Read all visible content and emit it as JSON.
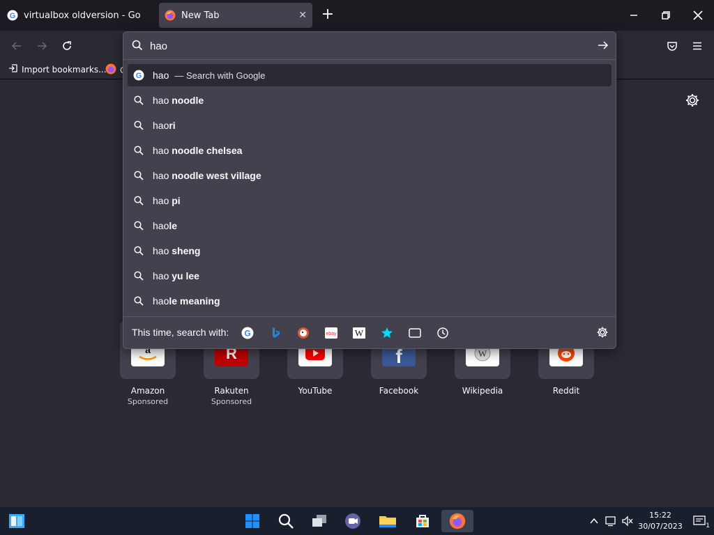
{
  "tabs": [
    {
      "title": "virtualbox oldversion - Google Se",
      "favicon": "google-icon"
    },
    {
      "title": "New Tab",
      "favicon": "firefox-icon"
    }
  ],
  "window_controls": [
    "minimize-icon",
    "restore-icon",
    "close-icon"
  ],
  "bookmarks": {
    "import_label": "Import bookmarks...",
    "next_label": "G"
  },
  "urlbar": {
    "value": "hao"
  },
  "suggestions": [
    {
      "prefix": "hao",
      "suffix": "",
      "action": "— Search with Google",
      "icon": "google-icon"
    },
    {
      "prefix": "hao ",
      "suffix": "noodle",
      "icon": "search-icon"
    },
    {
      "prefix": "hao",
      "suffix": "ri",
      "icon": "search-icon"
    },
    {
      "prefix": "hao ",
      "suffix": "noodle chelsea",
      "icon": "search-icon"
    },
    {
      "prefix": "hao ",
      "suffix": "noodle west village",
      "icon": "search-icon"
    },
    {
      "prefix": "hao ",
      "suffix": "pi",
      "icon": "search-icon"
    },
    {
      "prefix": "hao",
      "suffix": "le",
      "icon": "search-icon"
    },
    {
      "prefix": "hao ",
      "suffix": "sheng",
      "icon": "search-icon"
    },
    {
      "prefix": "hao ",
      "suffix": "yu lee",
      "icon": "search-icon"
    },
    {
      "prefix": "hao",
      "suffix": "le meaning",
      "icon": "search-icon"
    }
  ],
  "search_with": {
    "label": "This time, search with:",
    "engines": [
      "google-icon",
      "bing-icon",
      "duckduckgo-icon",
      "ebay-icon",
      "wikipedia-icon",
      "bookmarks-star-icon",
      "tabs-icon",
      "history-icon"
    ]
  },
  "tiles": [
    {
      "name": "Amazon",
      "sponsored": "Sponsored"
    },
    {
      "name": "Rakuten",
      "sponsored": "Sponsored"
    },
    {
      "name": "YouTube",
      "sponsored": ""
    },
    {
      "name": "Facebook",
      "sponsored": ""
    },
    {
      "name": "Wikipedia",
      "sponsored": ""
    },
    {
      "name": "Reddit",
      "sponsored": ""
    }
  ],
  "taskbar": {
    "time": "15:22",
    "date": "30/07/2023",
    "notification_count": "1"
  },
  "colors": {
    "accent": "#0060df",
    "firefox_orange": "#ff7139",
    "panel": "#42414d",
    "page": "#2b2a33"
  }
}
